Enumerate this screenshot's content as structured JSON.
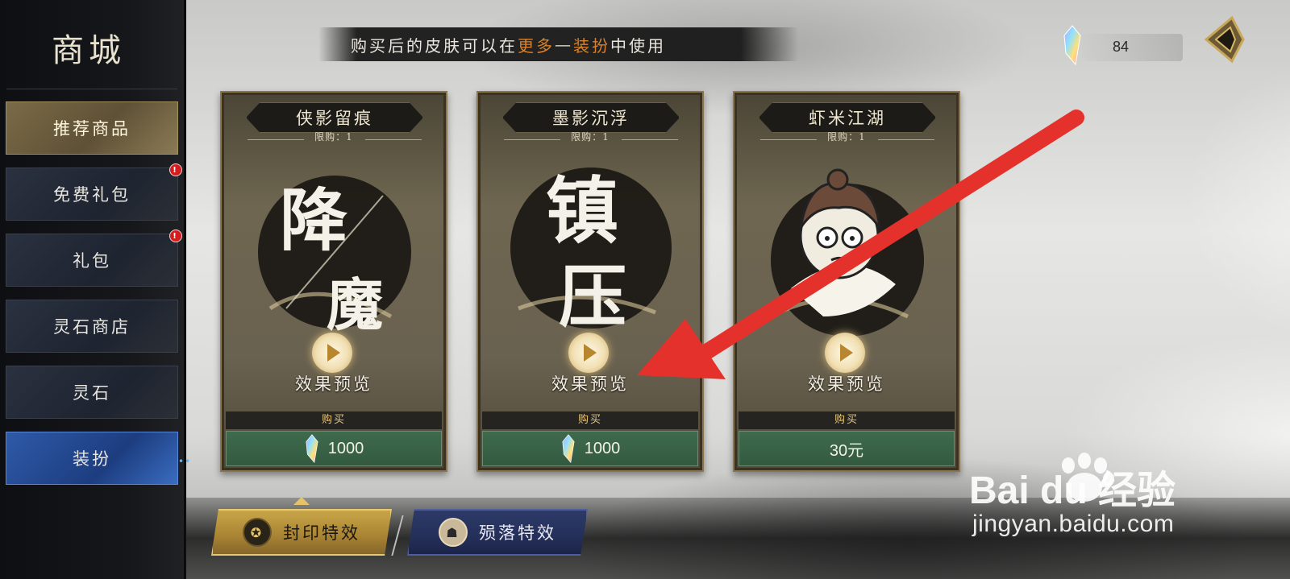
{
  "sidebar": {
    "title": "商城",
    "items": [
      {
        "label": "推荐商品",
        "state": "active",
        "badge": ""
      },
      {
        "label": "免费礼包",
        "state": "normal",
        "badge": "!"
      },
      {
        "label": "礼包",
        "state": "normal",
        "badge": "!"
      },
      {
        "label": "灵石商店",
        "state": "normal",
        "badge": ""
      },
      {
        "label": "灵石",
        "state": "normal",
        "badge": ""
      },
      {
        "label": "装扮",
        "state": "selected",
        "badge": ""
      }
    ],
    "more_indicator": "••"
  },
  "banner": {
    "prefix": "购买后的皮肤可以在",
    "highlight1": "更多",
    "dash": "—",
    "highlight2": "装扮",
    "suffix": "中使用"
  },
  "currency": {
    "value": "84",
    "icon": "spirit-stone-icon"
  },
  "back_button": {
    "icon": "back-arrow-icon"
  },
  "cards": [
    {
      "name": "侠影留痕",
      "limit": "限购：1",
      "art_text": [
        "降",
        "魔"
      ],
      "preview": "效果预览",
      "buy_label": "购买",
      "price": "1000",
      "price_icon": "spirit-stone-icon"
    },
    {
      "name": "墨影沉浮",
      "limit": "限购：1",
      "art_text": [
        "镇",
        "压"
      ],
      "preview": "效果预览",
      "buy_label": "购买",
      "price": "1000",
      "price_icon": "spirit-stone-icon"
    },
    {
      "name": "虾米江湖",
      "limit": "限购：1",
      "art_text": [],
      "preview": "效果预览",
      "buy_label": "购买",
      "price": "30元",
      "price_icon": ""
    }
  ],
  "bottom_tabs": [
    {
      "label": "封印特效",
      "icon": "seal-icon",
      "active": true
    },
    {
      "label": "殒落特效",
      "icon": "fallen-icon",
      "active": false
    }
  ],
  "watermark": {
    "brand": "Bai du 经验",
    "url": "jingyan.baidu.com"
  },
  "colors": {
    "highlight": "#d9822b",
    "buy_green": "#3f6a4d",
    "arrow_red": "#e5312b"
  }
}
